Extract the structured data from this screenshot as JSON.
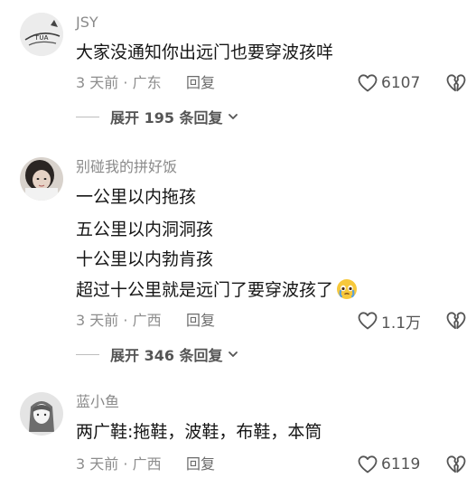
{
  "comments": [
    {
      "username": "JSY",
      "lines": [
        "大家没通知你出远门也要穿波孩咩"
      ],
      "time": "3 天前",
      "separator": "·",
      "location": "广东",
      "reply_label": "回复",
      "likes": "6107",
      "expand_label": "展开 195 条回复",
      "avatar_icon": "sketch-avatar"
    },
    {
      "username": "别碰我的拼好饭",
      "lines": [
        "一公里以内拖孩",
        "五公里以内洞洞孩",
        "十公里以内勃肯孩",
        "超过十公里就是远门了要穿波孩了"
      ],
      "emoji_icon": "pleading-tears-emoji",
      "time": "3 天前",
      "separator": "·",
      "location": "广西",
      "reply_label": "回复",
      "likes": "1.1万",
      "expand_label": "展开 346 条回复",
      "avatar_icon": "photo-avatar"
    },
    {
      "username": "蓝小鱼",
      "lines": [
        "两广鞋:拖鞋，波鞋，布鞋，本筒"
      ],
      "time": "3 天前",
      "separator": "·",
      "location": "广西",
      "reply_label": "回复",
      "likes": "6119",
      "avatar_icon": "drawn-girl-avatar"
    }
  ],
  "colors": {
    "username": "#8a8a8a",
    "text": "#161616",
    "meta": "#8d8d8d",
    "icon": "#555555"
  }
}
